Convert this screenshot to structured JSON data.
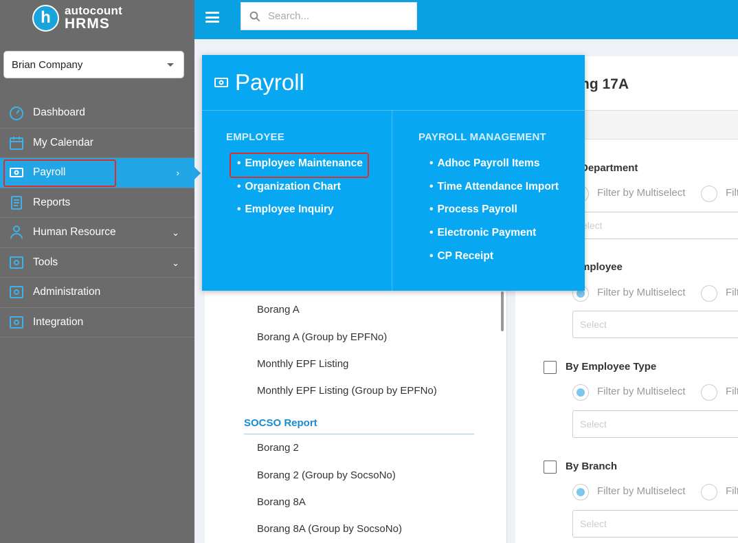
{
  "brand": {
    "logo_letter": "h",
    "name_top": "autocount",
    "name_bottom": "HRMS"
  },
  "company": {
    "selected": "Brian Company"
  },
  "nav": {
    "items": [
      {
        "label": "Dashboard",
        "icon": "dashboard-icon"
      },
      {
        "label": "My Calendar",
        "icon": "calendar-icon"
      },
      {
        "label": "Payroll",
        "icon": "payroll-icon",
        "chevron": "›",
        "active": true
      },
      {
        "label": "Reports",
        "icon": "reports-icon"
      },
      {
        "label": "Human Resource",
        "icon": "human-resource-icon",
        "chevron": "⌄"
      },
      {
        "label": "Tools",
        "icon": "tools-icon",
        "chevron": "⌄"
      },
      {
        "label": "Administration",
        "icon": "administration-icon"
      },
      {
        "label": "Integration",
        "icon": "integration-icon"
      }
    ]
  },
  "search": {
    "placeholder": "Search..."
  },
  "colors": {
    "topbar": "#0aa1e2",
    "sidebar": "#6b6b6b",
    "active": "#22a6e6",
    "highlight": "#d9302b",
    "mega": "#07a7f2"
  },
  "left_panel": {
    "items": [
      "Borang A",
      "Borang A (Group by EPFNo)",
      "Monthly EPF Listing",
      "Monthly EPF Listing (Group by EPFNo)"
    ],
    "section": "SOCSO Report",
    "section_items": [
      "Borang 2",
      "Borang 2 (Group by SocsoNo)",
      "Borang 8A",
      "Borang 8A (Group by SocsoNo)"
    ]
  },
  "right_panel": {
    "title": "ng 17A",
    "filters": [
      {
        "label": "Department"
      },
      {
        "label": "mployee"
      },
      {
        "label": "By Employee Type"
      },
      {
        "label": "By Branch"
      }
    ],
    "radio_multi": "Filter by Multiselect",
    "radio_other": "Filt",
    "select_placeholder_partial": "elect",
    "select_placeholder": "Select"
  },
  "mega": {
    "title": "Payroll",
    "employee": {
      "heading": "EMPLOYEE",
      "links": [
        "Employee Maintenance",
        "Organization Chart",
        "Employee Inquiry"
      ]
    },
    "payroll_management": {
      "heading": "PAYROLL MANAGEMENT",
      "links": [
        "Adhoc Payroll Items",
        "Time Attendance Import",
        "Process Payroll",
        "Electronic Payment",
        "CP Receipt"
      ]
    }
  }
}
